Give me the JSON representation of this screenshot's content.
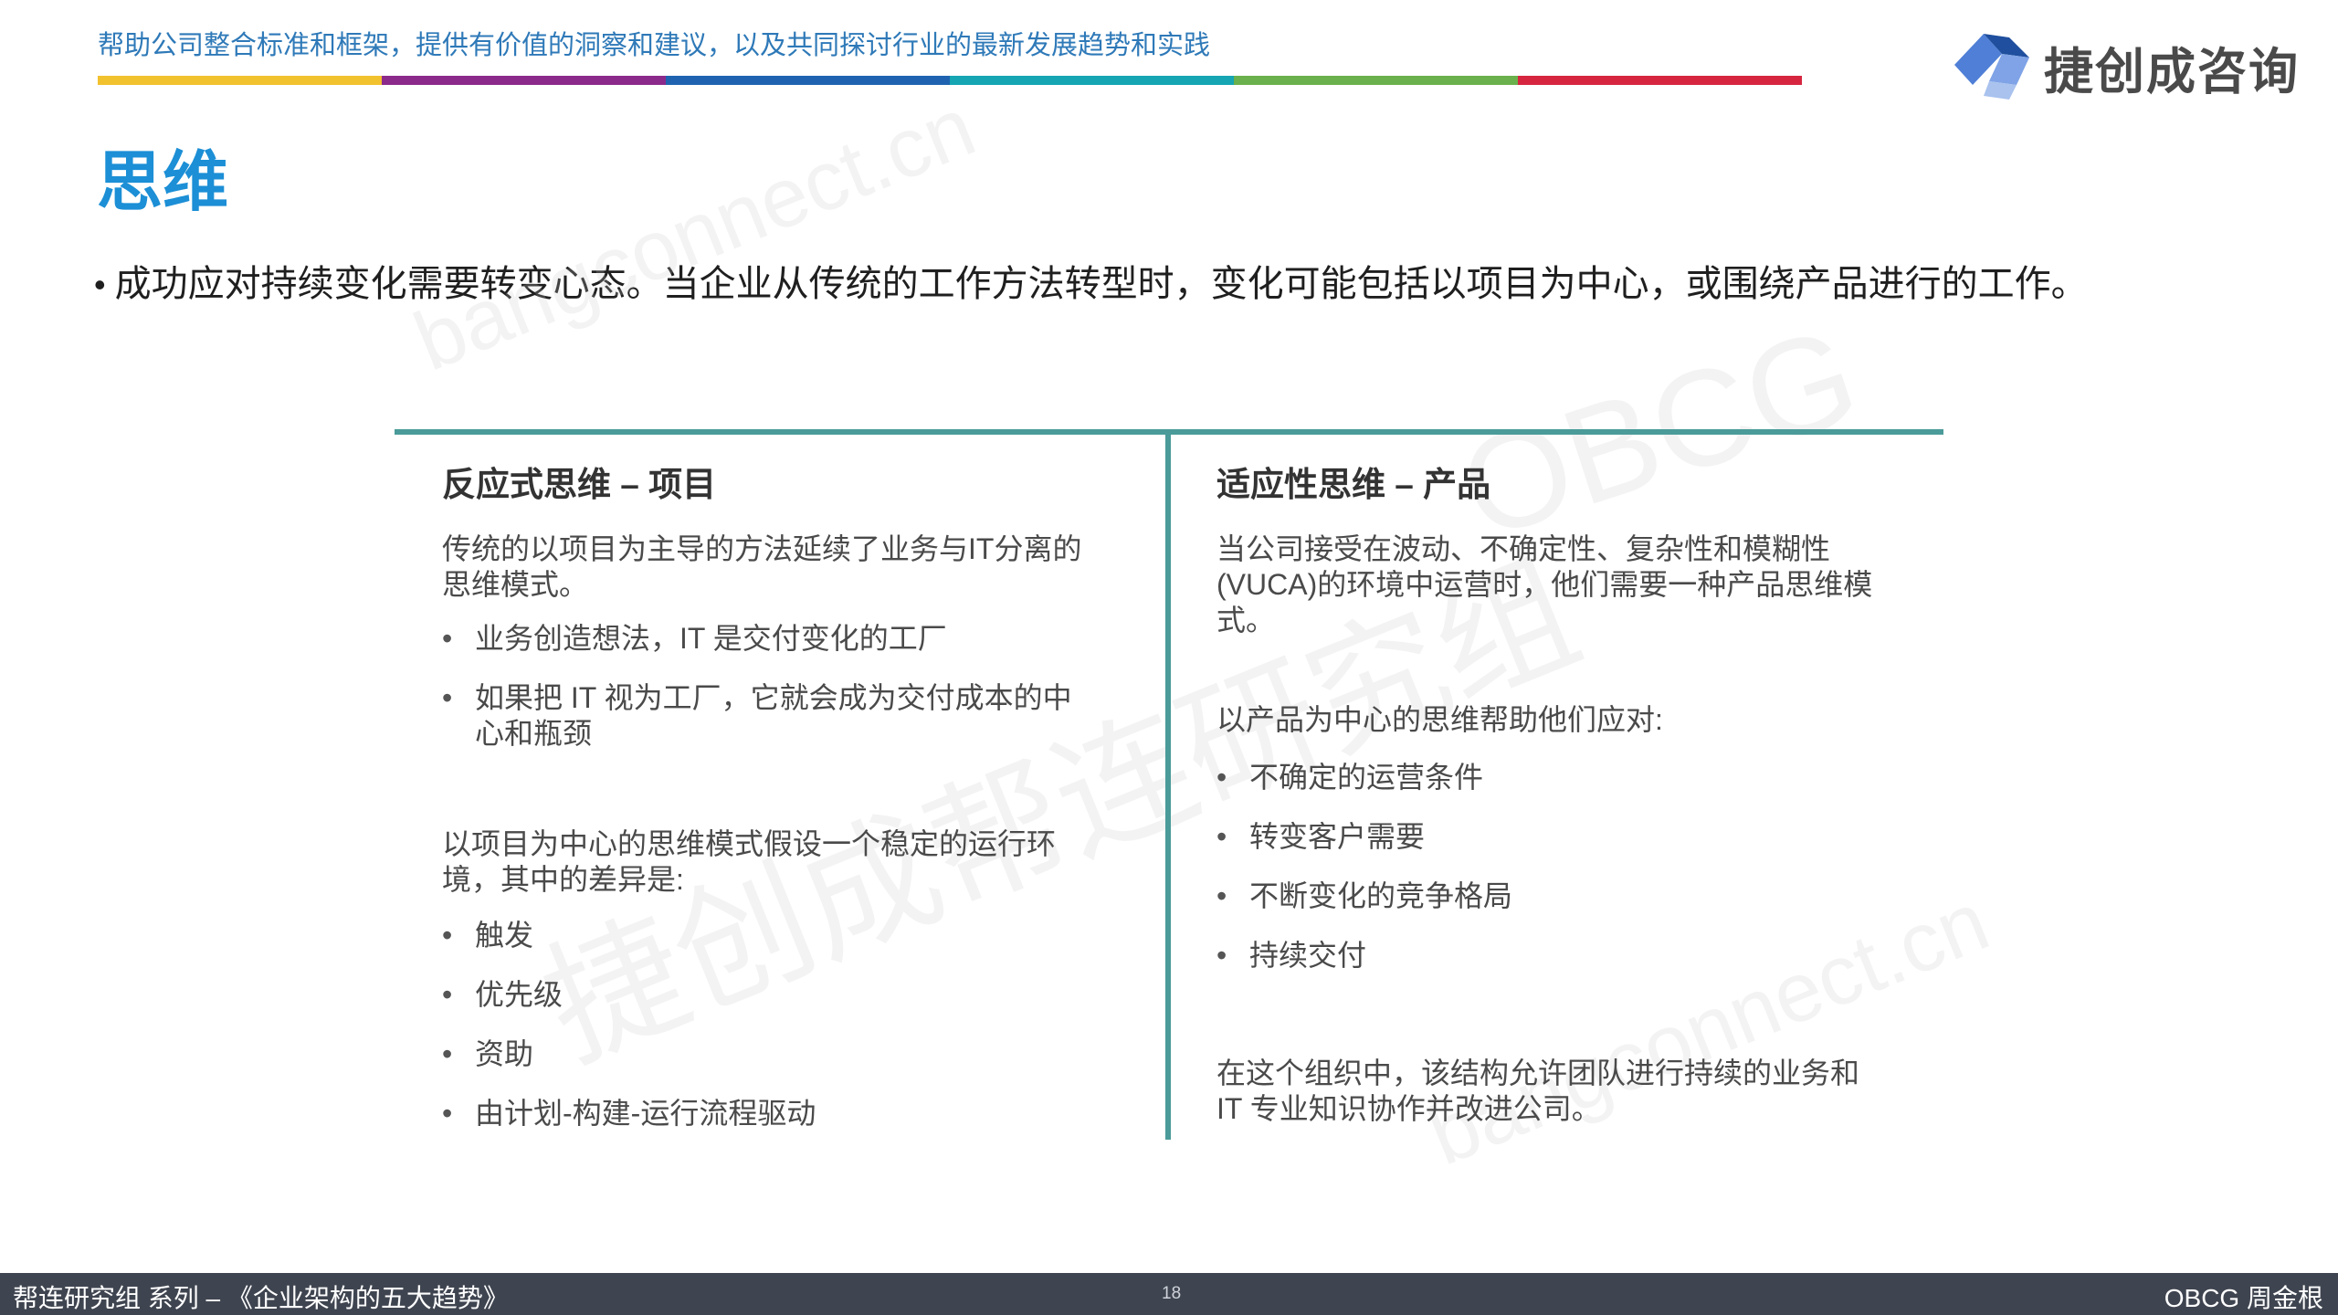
{
  "header": {
    "tagline": "帮助公司整合标准和框架，提供有价值的洞察和建议，以及共同探讨行业的最新发展趋势和实践",
    "color_bar": [
      "#f2c12e",
      "#8b2a8b",
      "#1f63b0",
      "#15a5b3",
      "#6ab04c",
      "#d6263f"
    ],
    "logo_icon": "cube-logo-icon",
    "logo_text": "捷创成咨询"
  },
  "title": "思维",
  "lead_text": "成功应对持续变化需要转变心态。当企业从传统的工作方法转型时，变化可能包括以项目为中心，或围绕产品进行的工作。",
  "divider_color": "#4a9b99",
  "left_column": {
    "title": "反应式思维 – 项目",
    "intro": "传统的以项目为主导的方法延续了业务与IT分离的思维模式。",
    "bullets_1": [
      "业务创造想法，IT 是交付变化的工厂",
      "如果把 IT 视为工厂，它就会成为交付成本的中心和瓶颈"
    ],
    "para_2": "以项目为中心的思维模式假设一个稳定的运行环境，其中的差异是:",
    "bullets_2": [
      "触发",
      "优先级",
      "资助",
      "由计划-构建-运行流程驱动"
    ]
  },
  "right_column": {
    "title": "适应性思维 – 产品",
    "intro": "当公司接受在波动、不确定性、复杂性和模糊性(VUCA)的环境中运营时，他们需要一种产品思维模式。",
    "para_2": "以产品为中心的思维帮助他们应对:",
    "bullets": [
      "不确定的运营条件",
      "转变客户需要",
      "不断变化的竞争格局",
      "持续交付"
    ],
    "closing": "在这个组织中，该结构允许团队进行持续的业务和 IT 专业知识协作并改进公司。"
  },
  "watermarks": [
    "bangconnect.cn",
    "OBCG",
    "捷创成帮连研究组",
    "bangconnect.cn"
  ],
  "footer": {
    "left": "帮连研究组 系列  – 《企业架构的五大趋势》",
    "page": "18",
    "right": "OBCG 周金根",
    "background": "#3f4550"
  }
}
